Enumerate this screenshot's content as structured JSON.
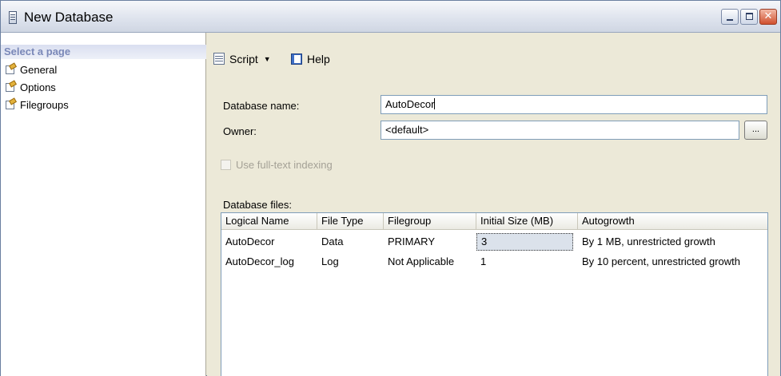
{
  "window": {
    "title": "New Database"
  },
  "sidebar": {
    "header": "Select a page",
    "items": [
      {
        "label": "General",
        "icon": "page-settings-icon"
      },
      {
        "label": "Options",
        "icon": "page-settings-icon"
      },
      {
        "label": "Filegroups",
        "icon": "page-settings-icon"
      }
    ]
  },
  "toolbar": {
    "script_label": "Script",
    "help_label": "Help"
  },
  "form": {
    "database_name_label": "Database name:",
    "database_name_value": "AutoDecor",
    "owner_label": "Owner:",
    "owner_value": "<default>",
    "owner_browse_label": "...",
    "fulltext_label": "Use full-text indexing",
    "fulltext_checked": false,
    "files_label": "Database files:"
  },
  "files_table": {
    "columns": [
      "Logical Name",
      "File Type",
      "Filegroup",
      "Initial Size (MB)",
      "Autogrowth"
    ],
    "rows": [
      [
        "AutoDecor",
        "Data",
        "PRIMARY",
        "3",
        "By 1 MB, unrestricted growth"
      ],
      [
        "AutoDecor_log",
        "Log",
        "Not Applicable",
        "1",
        "By 10 percent, unrestricted growth"
      ]
    ]
  }
}
